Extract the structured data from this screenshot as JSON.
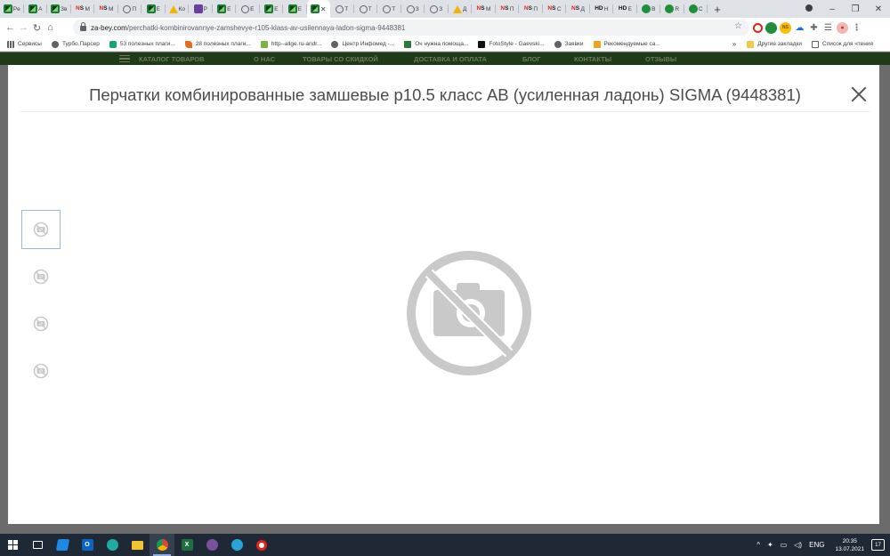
{
  "browser": {
    "tabs": [
      {
        "icon": "green-square-icon",
        "label": "Pe"
      },
      {
        "icon": "green-square-icon",
        "label": "A"
      },
      {
        "icon": "green-square-icon",
        "label": "Зв"
      },
      {
        "icon": "ns-logo-icon",
        "label": "M"
      },
      {
        "icon": "ns-logo-icon",
        "label": "M"
      },
      {
        "icon": "globe-icon",
        "label": "П"
      },
      {
        "icon": "green-square-icon",
        "label": "Е"
      },
      {
        "icon": "drive-icon",
        "label": "Ко"
      },
      {
        "icon": "purple-square-icon",
        "label": "Р"
      },
      {
        "icon": "green-square-icon",
        "label": "Е"
      },
      {
        "icon": "globe-icon",
        "label": "Е"
      },
      {
        "icon": "green-square-icon",
        "label": "Е"
      },
      {
        "icon": "green-square-icon",
        "label": "Е"
      },
      {
        "icon": "green-square-icon",
        "label": "",
        "active": true
      },
      {
        "icon": "globe-icon",
        "label": "Т"
      },
      {
        "icon": "globe-icon",
        "label": "Т"
      },
      {
        "icon": "globe-icon",
        "label": "Т"
      },
      {
        "icon": "globe-icon",
        "label": "З"
      },
      {
        "icon": "globe-icon",
        "label": "З"
      },
      {
        "icon": "drive-icon",
        "label": "Д"
      },
      {
        "icon": "ns-logo-icon",
        "label": "M"
      },
      {
        "icon": "ns-logo-icon",
        "label": "П"
      },
      {
        "icon": "ns-logo-icon",
        "label": "П"
      },
      {
        "icon": "ns-logo-icon",
        "label": "С"
      },
      {
        "icon": "ns-logo-icon",
        "label": "Д"
      },
      {
        "icon": "hd-logo-icon",
        "label": "Н"
      },
      {
        "icon": "hd-logo-icon",
        "label": "Е"
      },
      {
        "icon": "ac-logo-icon",
        "label": "В"
      },
      {
        "icon": "ac-logo-icon",
        "label": "R"
      },
      {
        "icon": "ac-logo-icon",
        "label": "С"
      }
    ],
    "active_tab_close": "✕",
    "new_tab": "+",
    "window_controls": {
      "minimize": "–",
      "maximize": "❐",
      "close": "✕"
    },
    "url_host": "za-bey.com",
    "url_path": "/perchatki-kombinirovannye-zamshevye-r105-klass-av-usilennaya-ladon-sigma-9448381",
    "bookmarks": [
      {
        "icon": "grid-icon",
        "label": "Сервисы"
      },
      {
        "icon": "globe-icon",
        "label": "Турбо.Парсер"
      },
      {
        "icon": "cyan-square-icon",
        "label": "53 полезных плаги..."
      },
      {
        "icon": "bird-icon",
        "label": "28 полезных плаги..."
      },
      {
        "icon": "spreadsheet-icon",
        "label": "http--allge.ru-andr..."
      },
      {
        "icon": "globe-icon",
        "label": "Центр Инфомед -..."
      },
      {
        "icon": "image-icon",
        "label": "Оч нужна помоща..."
      },
      {
        "icon": "photo-icon",
        "label": "FotoStyle - Gaevski..."
      },
      {
        "icon": "globe-icon",
        "label": "Заявки"
      },
      {
        "icon": "yellow-b-icon",
        "label": "Рекомендуемые са..."
      }
    ],
    "bookmarks_more": "»",
    "bookmarks_other": "Другие закладки",
    "reading_list": "Список для чтения"
  },
  "site_nav": {
    "items": [
      "Каталог товаров",
      "О нас",
      "Товары со скидкой",
      "Доставка и оплата",
      "Блог",
      "Контакты",
      "Отзывы"
    ]
  },
  "modal": {
    "title": "Перчатки комбинированные замшевые р10.5 класс АВ (усиленная ладонь) SIGMA (9448381)",
    "thumbnails": 4,
    "placeholder_icon": "no-photo-icon"
  },
  "taskbar": {
    "apps": [
      "windows-start-icon",
      "task-view-icon",
      "visual-studio-icon",
      "outlook-icon",
      "edge-icon",
      "file-explorer-icon",
      "chrome-icon",
      "excel-icon",
      "viber-icon",
      "telegram-icon",
      "opera-icon"
    ],
    "language": "ENG",
    "time": "20:35",
    "date": "13.07.2021",
    "notifications": "17"
  }
}
